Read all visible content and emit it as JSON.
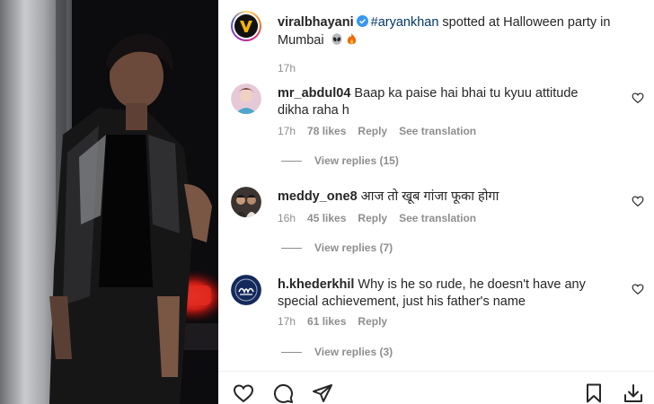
{
  "post": {
    "username": "viralbhayani",
    "hashtag": "#aryankhan",
    "caption": " spotted at Halloween party in Mumbai",
    "time": "17h"
  },
  "comments": [
    {
      "username": "mr_abdul04",
      "text": "Baap ka paise hai bhai tu kyuu attitude dikha raha h",
      "time": "17h",
      "likes": "78 likes",
      "reply": "Reply",
      "translation": "See translation",
      "view_replies": "View replies (15)"
    },
    {
      "username": "meddy_one8",
      "text": "आज तो खूब गांजा फूका होगा",
      "time": "16h",
      "likes": "45 likes",
      "reply": "Reply",
      "translation": "See translation",
      "view_replies": "View replies (7)"
    },
    {
      "username": "h.khederkhil",
      "text": "Why is he so rude, he doesn't have any special achievement, just his father's name",
      "time": "17h",
      "likes": "61 likes",
      "reply": "Reply",
      "view_replies": "View replies (3)"
    }
  ],
  "colors": {
    "text": "#262626",
    "muted": "#8e8e8e",
    "link": "#00376b",
    "verified": "#3897f0"
  },
  "icons": {
    "verified": "verified-badge-icon",
    "like": "heart-icon",
    "comment": "comment-bubble-icon",
    "share": "paper-plane-icon",
    "save": "bookmark-icon",
    "download": "download-icon"
  }
}
